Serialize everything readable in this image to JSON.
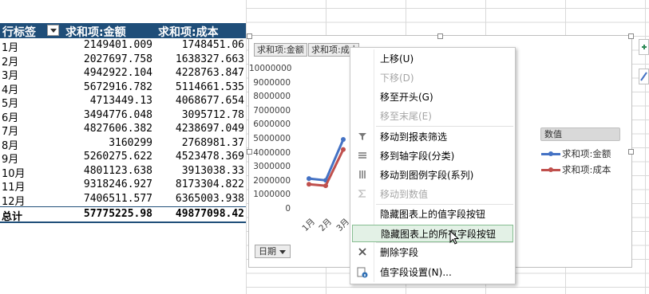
{
  "pivot": {
    "headers": [
      "行标签",
      "求和项:金额",
      "求和项:成本"
    ],
    "rows": [
      {
        "month": "1月",
        "amount": "2149401.009",
        "cost": "1748451.06"
      },
      {
        "month": "2月",
        "amount": "2027697.758",
        "cost": "1638327.663"
      },
      {
        "month": "3月",
        "amount": "4942922.104",
        "cost": "4228763.847"
      },
      {
        "month": "4月",
        "amount": "5672916.782",
        "cost": "5114661.535"
      },
      {
        "month": "5月",
        "amount": "4713449.13",
        "cost": "4068677.654"
      },
      {
        "month": "6月",
        "amount": "3494776.048",
        "cost": "3095712.78"
      },
      {
        "month": "7月",
        "amount": "4827606.382",
        "cost": "4238697.049"
      },
      {
        "month": "8月",
        "amount": "3160299",
        "cost": "2768981.37"
      },
      {
        "month": "9月",
        "amount": "5260275.622",
        "cost": "4523478.369"
      },
      {
        "month": "10月",
        "amount": "4801123.638",
        "cost": "3913038.33"
      },
      {
        "month": "11月",
        "amount": "9318246.927",
        "cost": "8173304.822"
      },
      {
        "month": "12月",
        "amount": "7406511.577",
        "cost": "6365003.938"
      }
    ],
    "total": {
      "label": "总计",
      "amount": "57775225.98",
      "cost": "49877098.42"
    }
  },
  "chart": {
    "field_buttons": [
      "求和项:金额",
      "求和项:成本"
    ],
    "axis_field_button": "日期",
    "legend_title": "数值",
    "legend": [
      "求和项:金额",
      "求和项:成本"
    ],
    "colors": {
      "amount": "#4472c4",
      "cost": "#c0504d"
    },
    "y_ticks": [
      "10000000",
      "9000000",
      "8000000",
      "7000000",
      "6000000",
      "5000000",
      "4000000",
      "3000000",
      "2000000",
      "1000000",
      "0"
    ],
    "x_ticks_visible": [
      "1月",
      "2月",
      "3月"
    ]
  },
  "chart_data": {
    "type": "line",
    "categories": [
      "1月",
      "2月",
      "3月"
    ],
    "series": [
      {
        "name": "求和项:金额",
        "values": [
          2149401.009,
          2027697.758,
          4942922.104
        ]
      },
      {
        "name": "求和项:成本",
        "values": [
          1748451.06,
          1638327.663,
          4228763.847
        ]
      }
    ],
    "ylim": [
      0,
      10000000
    ],
    "legend": "right"
  },
  "menu": {
    "items": [
      {
        "label": "上移(U)",
        "disabled": false,
        "icon": ""
      },
      {
        "label": "下移(D)",
        "disabled": true,
        "icon": ""
      },
      {
        "label": "移至开头(G)",
        "disabled": false,
        "icon": ""
      },
      {
        "label": "移至末尾(E)",
        "disabled": true,
        "icon": ""
      },
      {
        "label": "移动到报表筛选",
        "disabled": false,
        "icon": "filter-icon"
      },
      {
        "label": "移到轴字段(分类)",
        "disabled": false,
        "icon": "rows-icon"
      },
      {
        "label": "移动到图例字段(系列)",
        "disabled": false,
        "icon": "columns-icon"
      },
      {
        "label": "移动到数值",
        "disabled": true,
        "icon": "sigma-icon"
      },
      {
        "label": "隐藏图表上的值字段按钮",
        "disabled": false,
        "icon": ""
      },
      {
        "label": "隐藏图表上的所有字段按钮",
        "disabled": false,
        "icon": "",
        "highlighted": true
      },
      {
        "label": "删除字段",
        "disabled": false,
        "icon": "delete-icon"
      },
      {
        "label": "值字段设置(N)...",
        "disabled": false,
        "icon": "field-settings-icon"
      }
    ]
  }
}
